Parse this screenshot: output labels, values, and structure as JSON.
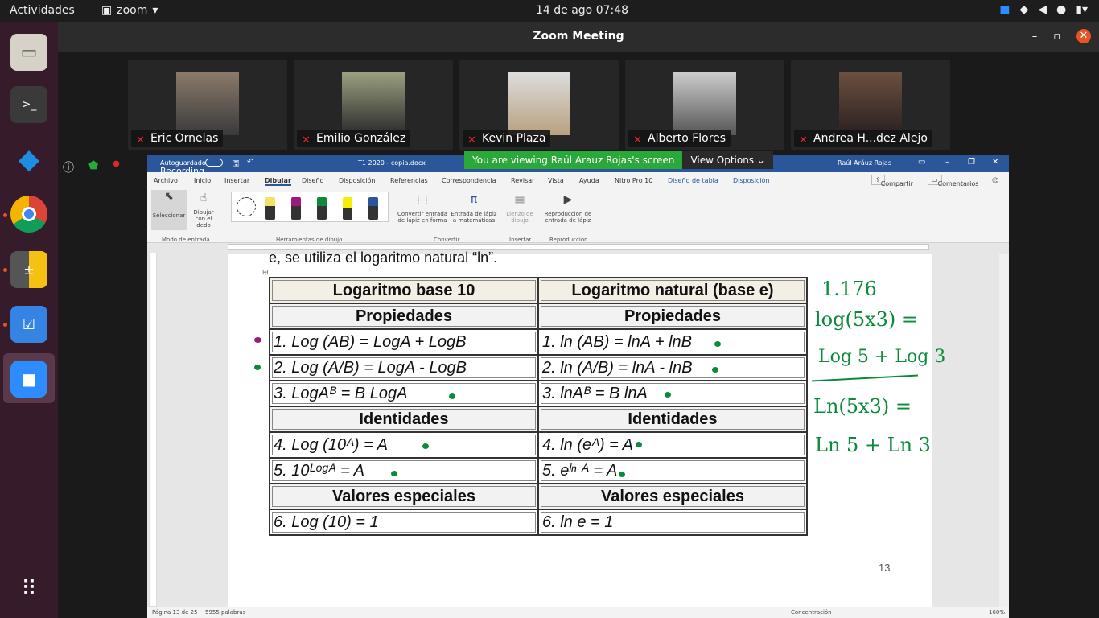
{
  "topbar": {
    "activities": "Actividades",
    "app": "zoom",
    "clock": "14 de ago  07:48"
  },
  "zoom": {
    "title": "Zoom Meeting",
    "banner": "You are viewing Raúl Arauz Rojas's screen",
    "view_options": "View Options",
    "recording": "Recording"
  },
  "participants": [
    {
      "name": "Eric Ornelas",
      "bg": "#6a5a4a"
    },
    {
      "name": "Emilio González",
      "bg": "#5a6a50"
    },
    {
      "name": "Kevin Plaza",
      "bg": "#c8c8c8"
    },
    {
      "name": "Alberto Flores",
      "bg": "#a0a0a0"
    },
    {
      "name": "Andrea H...dez Alejo",
      "bg": "#4a3a30"
    }
  ],
  "word": {
    "autosave": "Autoguardado",
    "doc": "T1 2020 - copia.docx",
    "user": "Raúl Aráuz Rojas",
    "menu": [
      "Archivo",
      "Inicio",
      "Insertar",
      "Dibujar",
      "Diseño",
      "Disposición",
      "Referencias",
      "Correspondencia",
      "Revisar",
      "Vista",
      "Ayuda",
      "Nitro Pro 10",
      "Diseño de tabla",
      "Disposición"
    ],
    "share": "Compartir",
    "comments": "Comentarios",
    "ribbon": {
      "select": "Seleccionar",
      "finger": "Dibujar con el dedo",
      "g1": "Modo de entrada",
      "g2": "Herramientas de dibujo",
      "convert1": "Convertir entrada de lápiz en forma",
      "convert2": "Entrada de lápiz a matemáticas",
      "g3": "Convertir",
      "canvas": "Lienzo de dibujo",
      "g4": "Insertar",
      "replay": "Reproducción de entrada de lápiz",
      "g5": "Reproducción"
    },
    "status": {
      "page": "Página 13 de 25",
      "words": "5955 palabras",
      "focus": "Concentración",
      "zoom": "160%"
    },
    "page_number": "13",
    "intro": "e, se utiliza el logaritmo natural “ln”."
  },
  "table": {
    "h_left": "Logaritmo base 10",
    "h_right": "Logaritmo natural (base e)",
    "props": "Propiedades",
    "idents": "Identidades",
    "special": "Valores especiales",
    "rows": [
      {
        "l": "1. Log (AB) = LogA + LogB",
        "r": "1. ln (AB) = lnA + lnB"
      },
      {
        "l": "2. Log (A/B) = LogA - LogB",
        "r": "2. ln (A/B) = lnA - lnB"
      },
      {
        "l": "3. LogAᴮ = B LogA",
        "r": "3. lnAᴮ = B lnA"
      },
      {
        "l": "4. Log (10ᴬ) = A",
        "r": "4. ln (eᴬ) = A"
      },
      {
        "l": "5. 10ᴸᵒᵍᴬ = A",
        "r": "5. eˡⁿ ᴬ = A"
      },
      {
        "l": "6. Log (10) = 1",
        "r": "6. ln e = 1"
      }
    ]
  },
  "handwriting": [
    "1.176",
    "log(5x3) =",
    "Log 5 + Log 3",
    "Ln(5x3) =",
    "Ln 5 + Ln 3"
  ]
}
